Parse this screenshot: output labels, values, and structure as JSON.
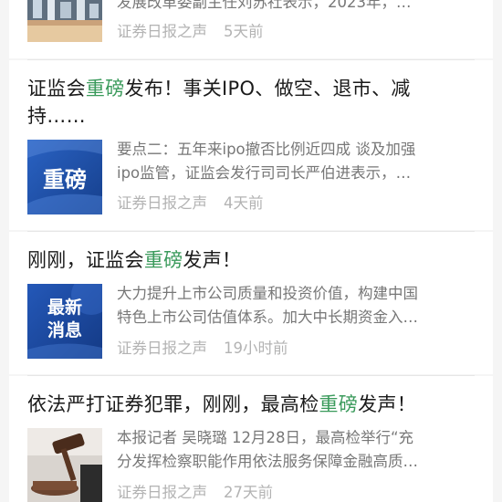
{
  "articles": [
    {
      "summary_lines": [
        "发展改革委副主任刘苏社表示，2023年，…"
      ],
      "source": "证券日报之声",
      "time": "5天前",
      "thumb_icon": "city-photo-thumbnail"
    },
    {
      "title_pre": "证监会",
      "title_hl": "重磅",
      "title_post_line1": "发布！事关IPO、做空、退市、减",
      "title_line2": "持……",
      "thumb_text": "重磅",
      "summary_lines": [
        "要点二：五年来ipo撤否比例近四成 谈及加强",
        "ipo监管，证监会发行司司长严伯进表示，…"
      ],
      "source": "证券日报之声",
      "time": "4天前"
    },
    {
      "title_pre": "刚刚，证监会",
      "title_hl": "重磅",
      "title_post": "发声！",
      "thumb_text_line1": "最新",
      "thumb_text_line2": "消息",
      "summary_lines": [
        "大力提升上市公司质量和投资价值，构建中国",
        "特色上市公司估值体系。加大中长期资金入…"
      ],
      "source": "证券日报之声",
      "time": "19小时前"
    },
    {
      "title_pre": "依法严打证券犯罪，刚刚，最高检",
      "title_hl": "重磅",
      "title_post": "发声！",
      "summary_lines": [
        "本报记者 吴晓璐 12月28日，最高检举行“充",
        "分发挥检察职能作用依法服务保障金融高质…"
      ],
      "source": "证券日报之声",
      "time": "27天前",
      "thumb_icon": "gavel-photo-thumbnail"
    }
  ],
  "colors": {
    "highlight": "#3a9a5b",
    "title": "#1a1a1a",
    "summary": "#777777",
    "meta": "#b3b3b3",
    "thumb_blue": "#1d4fa3"
  }
}
